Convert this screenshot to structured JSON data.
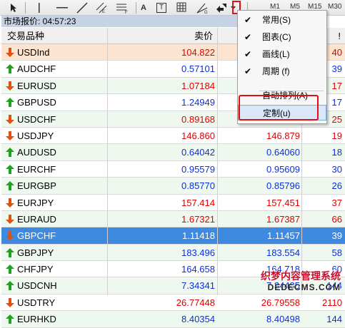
{
  "toolbar": {
    "text_tool": "A",
    "label_tool": "T",
    "timeframes": [
      "M1",
      "M5",
      "M15",
      "M30"
    ]
  },
  "window": {
    "title": "市场报价: 04:57:23"
  },
  "columns": {
    "symbol": "交易品种",
    "bid": "卖价",
    "spread": "!"
  },
  "rows": [
    {
      "symbol": "USDInd",
      "dir": "down",
      "bid": "104.822",
      "ask": "",
      "spread": "40"
    },
    {
      "symbol": "AUDCHF",
      "dir": "up",
      "bid": "0.57101",
      "ask": "",
      "spread": "39"
    },
    {
      "symbol": "EURUSD",
      "dir": "down",
      "bid": "1.07184",
      "ask": "",
      "spread": "17"
    },
    {
      "symbol": "GBPUSD",
      "dir": "up",
      "bid": "1.24949",
      "ask": "",
      "spread": "17"
    },
    {
      "symbol": "USDCHF",
      "dir": "down",
      "bid": "0.89168",
      "ask": "",
      "spread": "25"
    },
    {
      "symbol": "USDJPY",
      "dir": "down",
      "bid": "146.860",
      "ask": "146.879",
      "spread": "19"
    },
    {
      "symbol": "AUDUSD",
      "dir": "up",
      "bid": "0.64042",
      "ask": "0.64060",
      "spread": "18"
    },
    {
      "symbol": "EURCHF",
      "dir": "up",
      "bid": "0.95579",
      "ask": "0.95609",
      "spread": "30"
    },
    {
      "symbol": "EURGBP",
      "dir": "up",
      "bid": "0.85770",
      "ask": "0.85796",
      "spread": "26"
    },
    {
      "symbol": "EURJPY",
      "dir": "down",
      "bid": "157.414",
      "ask": "157.451",
      "spread": "37"
    },
    {
      "symbol": "EURAUD",
      "dir": "down",
      "bid": "1.67321",
      "ask": "1.67387",
      "spread": "66"
    },
    {
      "symbol": "GBPCHF",
      "dir": "down",
      "bid": "1.11418",
      "ask": "1.11457",
      "spread": "39"
    },
    {
      "symbol": "GBPJPY",
      "dir": "up",
      "bid": "183.496",
      "ask": "183.554",
      "spread": "58"
    },
    {
      "symbol": "CHFJPY",
      "dir": "up",
      "bid": "164.658",
      "ask": "164.718",
      "spread": "60"
    },
    {
      "symbol": "USDCNH",
      "dir": "up",
      "bid": "7.34341",
      "ask": "7.34485",
      "spread": "144"
    },
    {
      "symbol": "USDTRY",
      "dir": "down",
      "bid": "26.77448",
      "ask": "26.79558",
      "spread": "2110"
    },
    {
      "symbol": "EURHKD",
      "dir": "up",
      "bid": "8.40354",
      "ask": "8.40498",
      "spread": "144"
    }
  ],
  "selected_row": "GBPCHF",
  "menu": {
    "items": [
      {
        "label": "常用(S)",
        "checked": true
      },
      {
        "label": "图表(C)",
        "checked": true
      },
      {
        "label": "画线(L)",
        "checked": true
      },
      {
        "label": "周期 (f)",
        "checked": true
      },
      {
        "label": "自动排列(A)",
        "checked": false
      },
      {
        "label": "定制(u)",
        "checked": false
      }
    ]
  },
  "watermark": {
    "line1": "织梦内容管理系统",
    "line2": "DEDECMS.COM"
  },
  "colors": {
    "up": "#0b2fe0",
    "down": "#e00000",
    "selected": "#3d8ae0",
    "alt_row": "#eef8ee",
    "highlight_box": "#e01010"
  }
}
